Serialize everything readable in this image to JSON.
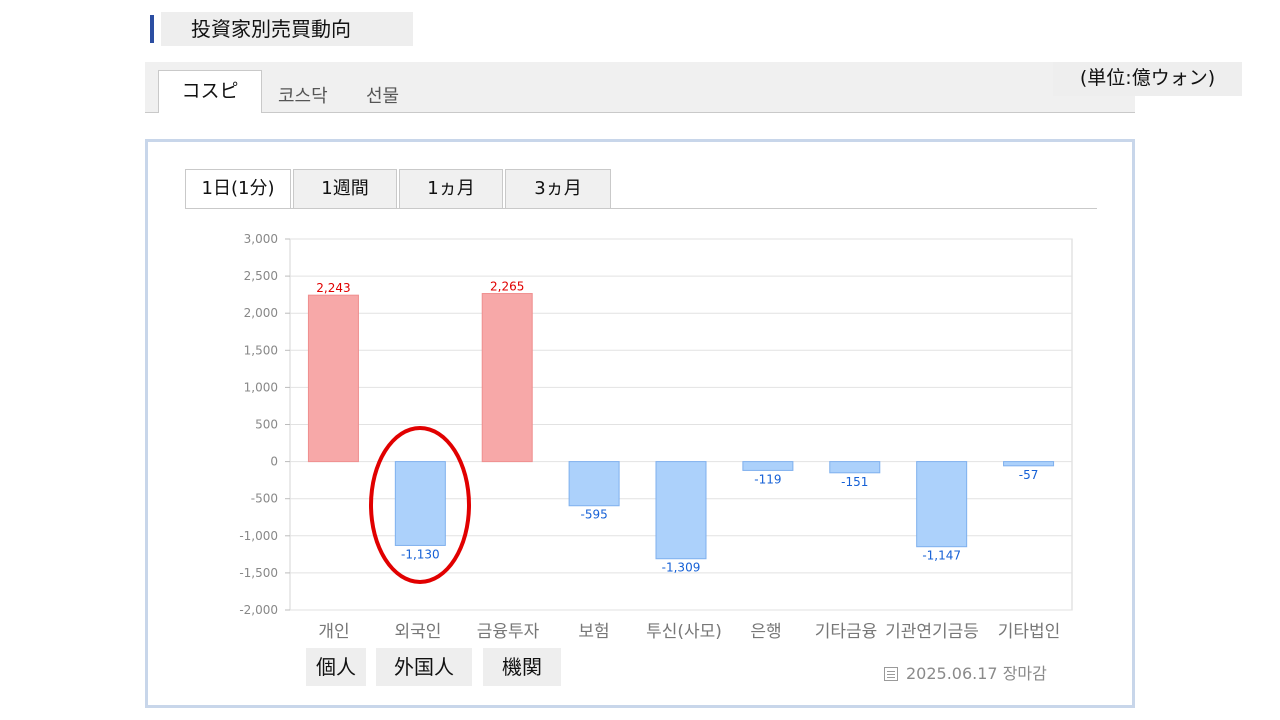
{
  "page": {
    "title": "投資家別売買動向",
    "unit": "(単位:億ウォン)"
  },
  "market_tabs": [
    {
      "label": "コスピ",
      "active": true
    },
    {
      "label": "코스닥",
      "active": false
    },
    {
      "label": "선물",
      "active": false
    }
  ],
  "period_tabs": [
    {
      "label": "1日(1分)",
      "active": true
    },
    {
      "label": "1週間",
      "active": false
    },
    {
      "label": "1ヵ月",
      "active": false
    },
    {
      "label": "3ヵ月",
      "active": false
    }
  ],
  "chart_data": {
    "type": "bar",
    "categories": [
      "개인",
      "외국인",
      "금융투자",
      "보험",
      "투신(사모)",
      "은행",
      "기타금융",
      "기관연기금등",
      "기타법인"
    ],
    "values": [
      2243,
      -1130,
      2265,
      -595,
      -1309,
      -119,
      -151,
      -1147,
      -57
    ],
    "value_labels": [
      "2,243",
      "-1,130",
      "2,265",
      "-595",
      "-1,309",
      "-119",
      "-151",
      "-1,147",
      "-57"
    ],
    "yticks": [
      "3,000",
      "2,500",
      "2,000",
      "1,500",
      "1,000",
      "500",
      "0",
      "-500",
      "-1,000",
      "-1,500",
      "-2,000"
    ],
    "ylim": [
      -2000,
      3000
    ],
    "grid": true,
    "colors": {
      "positive_fill": "#f7a8a8",
      "positive_stroke": "#ef8f8f",
      "positive_label": "#e00000",
      "negative_fill": "#acd1fb",
      "negative_stroke": "#7fb0ee",
      "negative_label": "#1560d6"
    }
  },
  "annotations": {
    "group_labels": [
      "個人",
      "外国人",
      "機関"
    ],
    "highlight": "외국인"
  },
  "footer": {
    "date": "2025.06.17 장마감"
  }
}
